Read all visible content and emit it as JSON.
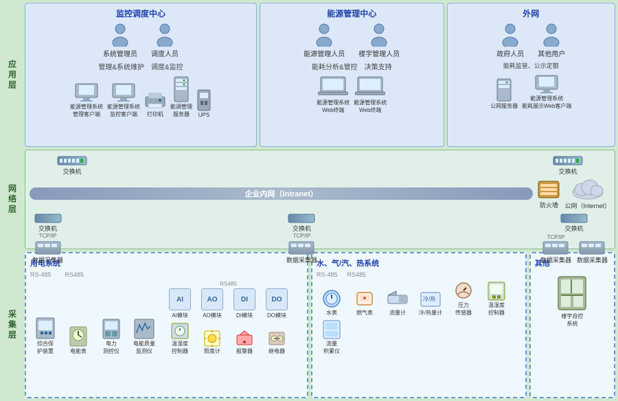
{
  "sections": {
    "top": {
      "monitoring_center": {
        "title": "监控调度中心",
        "persons": [
          "系统管理员",
          "调度人员"
        ],
        "labels": [
          "管理&系统维护",
          "调度&监控"
        ],
        "devices": [
          "能源管理系统\n管理客户端",
          "能源管理系统\n监控客户端",
          "打印机",
          "能调管理\n服务器",
          "UPS"
        ]
      },
      "energy_mgmt": {
        "title": "能源管理中心",
        "persons": [
          "能源管理人员",
          "楼宇管理人员"
        ],
        "labels": [
          "能耗分析&管控",
          "决策支持"
        ],
        "devices": [
          "能源管理系统\nWeb终端",
          "能源管理系统\nWeb终端"
        ]
      },
      "external_net": {
        "title": "外网",
        "persons": [
          "政府人员",
          "其他用户"
        ],
        "labels": [
          "能耗监管、公示定额"
        ],
        "devices": [
          "公网服务器",
          "能源管理系统\n能耗展示Web客户端"
        ]
      }
    },
    "middle": {
      "title": "网络层",
      "components": {
        "switches_top": [
          "交换机",
          "交换机"
        ],
        "intranet": "企业内网（Intranet）",
        "internet": "公网（Internet）",
        "firewall": "防火墙",
        "switches_bottom": [
          "交换机",
          "交换机",
          "交换机"
        ],
        "protocols": [
          "TCP/IP",
          "TCP/IP",
          "TCP/IP"
        ],
        "collectors": [
          "数据采集器",
          "数据采集器",
          "数据采集器",
          "数据采集器"
        ]
      }
    },
    "bottom": {
      "electricity_sys": {
        "title": "用电系统",
        "rs485": "RS-485",
        "rs485_2": "RS485",
        "rs485_3": "RS485",
        "devices": [
          "综合保\n护装置",
          "电能表",
          "电力\n测控仪",
          "电能质量\n监测仪"
        ],
        "modules": [
          "AI模块",
          "AO模块",
          "DI模块",
          "DO模块"
        ],
        "sub_devices": [
          "温湿度\n控制器",
          "照度计",
          "报警器",
          "继电器"
        ]
      },
      "water_gas_sys": {
        "title": "水、气/汽、热系统",
        "rs485": "RS-485",
        "rs485_2": "RS485",
        "devices": [
          "水表",
          "燃气表",
          "流量计",
          "冷/热量计",
          "压力\n传感器",
          "温湿度\n控制器",
          "流量\n积累仪"
        ]
      },
      "other_sys": {
        "title": "其他",
        "devices": [
          "楼宇自控\n系统"
        ]
      }
    }
  },
  "left_labels": {
    "top": "应用层",
    "middle": "网络层",
    "bottom": "采集层"
  }
}
